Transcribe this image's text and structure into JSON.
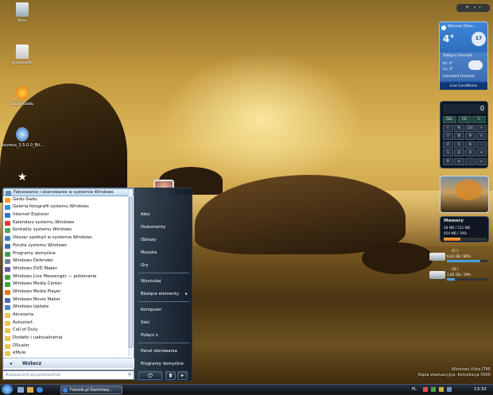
{
  "desktop_icons": [
    {
      "label": "Kosz",
      "name": "recycle-bin-icon",
      "color": "#c8d4dc"
    },
    {
      "label": "pizzawa8b",
      "name": "folder-icon",
      "color": "#e8e8e8"
    },
    {
      "label": "Gadu-Gadu",
      "name": "gadu-gadu-icon",
      "color": "#f2b41e"
    },
    {
      "label": "Azureus_2.5.0.0_Bit...",
      "name": "azureus-icon",
      "color": "#5fa0e0"
    }
  ],
  "weather": {
    "city": "Warsaw (Okec...",
    "temp": "4°",
    "date": "17",
    "forecast_title": "Today's Forecast",
    "hi": "Hi: 4°",
    "lo": "Lo: 0°",
    "condition": "Extended Forecast",
    "live": "Live Conditions"
  },
  "calculator": {
    "display": "0",
    "rows": [
      [
        "DEL",
        "CE",
        "C"
      ],
      [
        "√",
        "%",
        "1/x",
        "÷"
      ],
      [
        "7",
        "8",
        "9",
        "×"
      ],
      [
        "4",
        "5",
        "6",
        "-"
      ],
      [
        "1",
        "2",
        "3",
        "+"
      ],
      [
        "0",
        "±",
        ".",
        "="
      ]
    ]
  },
  "memory": {
    "title": "Memory",
    "line1": "58 MB / 512 MB",
    "line2": "454 MB / 39%"
  },
  "drives": [
    {
      "label": "(C:)",
      "info": "6,02 GB / 80%"
    },
    {
      "label": "(D:)",
      "info": "1,92 GB / 19%"
    }
  ],
  "gadget_top": {
    "add": "+",
    "prev": "‹",
    "next": "›"
  },
  "start_menu": {
    "programs": [
      {
        "label": "Faksowanie i skanowanie w systemie Windows",
        "hl": true,
        "color": "#6a8ab8"
      },
      {
        "label": "Gadu-Gadu",
        "color": "#f2a01e"
      },
      {
        "label": "Galeria fotografii systemu Windows",
        "color": "#3c8fd4"
      },
      {
        "label": "Internet Explorer",
        "color": "#2e74c8"
      },
      {
        "label": "Kalendarz systemu Windows",
        "color": "#d04040"
      },
      {
        "label": "Kontakty systemu Windows",
        "color": "#5aa05a"
      },
      {
        "label": "Obszar spotkań w systemie Windows",
        "color": "#3a80c0"
      },
      {
        "label": "Poczta systemu Windows",
        "color": "#3a70b0"
      },
      {
        "label": "Programy domyślne",
        "color": "#3aa05a"
      },
      {
        "label": "Windows Defender",
        "color": "#708090"
      },
      {
        "label": "Windows DVD Maker",
        "color": "#6060a0"
      },
      {
        "label": "Windows Live Messenger — pobieranie",
        "color": "#40a040"
      },
      {
        "label": "Windows Media Center",
        "color": "#40a040"
      },
      {
        "label": "Windows Media Player",
        "color": "#e07a20"
      },
      {
        "label": "Windows Movie Maker",
        "color": "#4a6ab0"
      },
      {
        "label": "Windows Update",
        "color": "#4a80c0"
      },
      {
        "label": "Akcesoria",
        "color": "#e8c25a"
      },
      {
        "label": "Autostart",
        "color": "#e8c25a"
      },
      {
        "label": "Call of Duty",
        "color": "#e8c25a"
      },
      {
        "label": "Dodatki i uaktualnienia",
        "color": "#e8c25a"
      },
      {
        "label": "DScaler",
        "color": "#e8c25a"
      },
      {
        "label": "eMule",
        "color": "#e8c25a"
      }
    ],
    "back": "Wstecz",
    "search_placeholder": "Rozpocznij wyszukiwanie",
    "right": [
      "Alex",
      "Dokumenty",
      "Obrazy",
      "Muzyka",
      "Gry",
      "Wyszukaj",
      "Bieżące elementy",
      "Komputer",
      "Sieć",
      "Połącz z",
      "Panel sterowania",
      "Programy domyślne"
    ]
  },
  "taskbar": {
    "task": "Fotosik.pl Darmowy...",
    "lang": "PL",
    "clock": "13:32"
  },
  "watermark": {
    "line1": "Windows Vista (TM)",
    "line2": "Kopia ewaluacyjna. Kompilacja 5600"
  }
}
